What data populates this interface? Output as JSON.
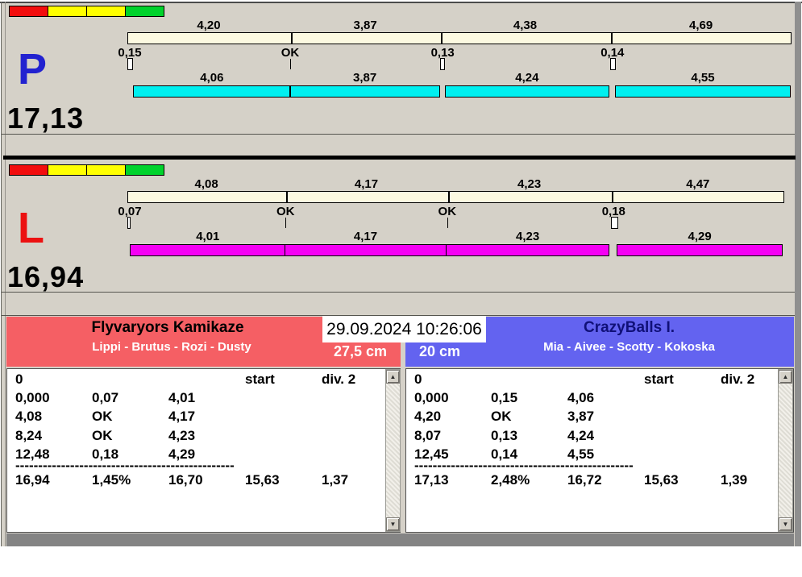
{
  "datetime": "29.09.2024 10:26:06",
  "icons": {
    "scroll_up": "▲",
    "scroll_down": "▼"
  },
  "colors": {
    "window_bg": "#D5D1C8",
    "ref_bar": "#FCF9E1",
    "status_bar": "#848484",
    "datetime_bg": "#FFFFFF"
  },
  "traffic_light": {
    "colors": [
      "#F20D0D",
      "#FFFF00",
      "#FFFF00",
      "#00D22C"
    ]
  },
  "lanes": [
    {
      "letter": "P",
      "letter_color": "#2222D0",
      "total": "17,13",
      "net_bar_color": "#00F0F0",
      "splits": [
        {
          "ref": "4,20",
          "cross": "0,15",
          "net": "4,06"
        },
        {
          "ref": "3,87",
          "cross": "OK",
          "net": "3,87"
        },
        {
          "ref": "4,38",
          "cross": "0,13",
          "net": "4,24"
        },
        {
          "ref": "4,69",
          "cross": "0,14",
          "net": "4,55"
        }
      ]
    },
    {
      "letter": "L",
      "letter_color": "#EC1111",
      "total": "16,94",
      "net_bar_color": "#F400F4",
      "splits": [
        {
          "ref": "4,08",
          "cross": "0,07",
          "net": "4,01"
        },
        {
          "ref": "4,17",
          "cross": "OK",
          "net": "4,17"
        },
        {
          "ref": "4,23",
          "cross": "OK",
          "net": "4,23"
        },
        {
          "ref": "4,47",
          "cross": "0,18",
          "net": "4,29"
        }
      ]
    }
  ],
  "teams": [
    {
      "name": "Flyvaryors Kamikaze",
      "dogs": "Lippi - Brutus - Rozi - Dusty",
      "jump_height": "27,5 cm",
      "header_color": "#F55F64",
      "name_color": "#000000",
      "table": {
        "first_cell": "0",
        "col_start": "start",
        "col_div": "div. 2",
        "rows": [
          [
            "0,000",
            "0,07",
            "4,01"
          ],
          [
            "4,08",
            "OK",
            "4,17"
          ],
          [
            "8,24",
            "OK",
            "4,23"
          ],
          [
            "12,48",
            "0,18",
            "4,29"
          ]
        ],
        "separator": "------------------------------------------------",
        "totals": [
          "16,94",
          "1,45%",
          "16,70",
          "15,63",
          "1,37"
        ]
      }
    },
    {
      "name": "CrazyBalls I.",
      "dogs": "Mia - Aivee - Scotty - Kokoska",
      "jump_height": "20 cm",
      "header_color": "#6363F0",
      "name_color": "#101078",
      "table": {
        "first_cell": "0",
        "col_start": "start",
        "col_div": "div. 2",
        "rows": [
          [
            "0,000",
            "0,15",
            "4,06"
          ],
          [
            "4,20",
            "OK",
            "3,87"
          ],
          [
            "8,07",
            "0,13",
            "4,24"
          ],
          [
            "12,45",
            "0,14",
            "4,55"
          ]
        ],
        "separator": "------------------------------------------------",
        "totals": [
          "17,13",
          "2,48%",
          "16,72",
          "15,63",
          "1,39"
        ]
      }
    }
  ]
}
